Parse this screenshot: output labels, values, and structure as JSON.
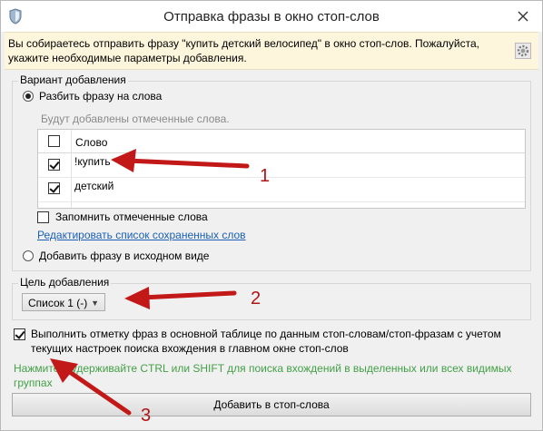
{
  "window": {
    "title": "Отправка фразы в окно стоп-слов",
    "close_icon": "close-icon",
    "app_icon": "shield-icon"
  },
  "info": {
    "text": "Вы собираетесь отправить фразу \"купить детский велосипед\" в окно стоп-слов. Пожалуйста, укажите необходимые параметры добавления.",
    "gear_icon": "gear-icon"
  },
  "variant_group": {
    "title": "Вариант добавления",
    "split_option": "Разбить фразу на слова",
    "split_selected": true,
    "hint": "Будут добавлены отмеченные слова.",
    "column_header": "Слово",
    "words": [
      {
        "label": "!купить",
        "checked": true
      },
      {
        "label": "детский",
        "checked": true
      }
    ],
    "remember_label": "Запомнить отмеченные слова",
    "remember_checked": false,
    "edit_link": "Редактировать список сохраненных слов",
    "original_option": "Добавить фразу в исходном виде",
    "original_selected": false
  },
  "target_group": {
    "title": "Цель добавления",
    "selected_list": "Список 1 (-)"
  },
  "mark_option": {
    "label": "Выполнить отметку фраз в основной таблице по данным стоп-словам/стоп-фразам с учетом текущих настроек поиска вхождения в главном окне стоп-слов",
    "checked": true
  },
  "hint_green": "Нажмите и удерживайте CTRL или SHIFT для поиска вхождений в выделенных или всех видимых группах",
  "submit_label": "Добавить в стоп-слова",
  "annotations": {
    "color": "#c21818",
    "labels": [
      "1",
      "2",
      "3"
    ]
  }
}
